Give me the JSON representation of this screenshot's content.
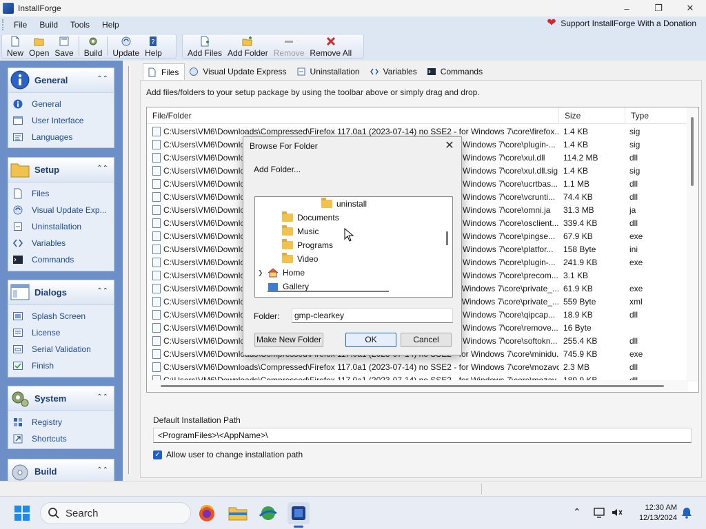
{
  "app": {
    "title": "InstallForge"
  },
  "menu": [
    "File",
    "Build",
    "Tools",
    "Help"
  ],
  "donate": "Support InstallForge With a Donation",
  "toolbar": {
    "new": "New",
    "open": "Open",
    "save": "Save",
    "build": "Build",
    "update": "Update",
    "help": "Help",
    "add_files": "Add Files",
    "add_folder": "Add Folder",
    "remove": "Remove",
    "remove_all": "Remove All"
  },
  "sidebar": {
    "general": {
      "title": "General",
      "items": [
        "General",
        "User Interface",
        "Languages"
      ]
    },
    "setup": {
      "title": "Setup",
      "items": [
        "Files",
        "Visual Update Exp...",
        "Uninstallation",
        "Variables",
        "Commands"
      ]
    },
    "dialogs": {
      "title": "Dialogs",
      "items": [
        "Splash Screen",
        "License",
        "Serial Validation",
        "Finish"
      ]
    },
    "system": {
      "title": "System",
      "items": [
        "Registry",
        "Shortcuts"
      ]
    },
    "build": {
      "title": "Build"
    }
  },
  "tabs": [
    "Files",
    "Visual Update Express",
    "Uninstallation",
    "Variables",
    "Commands"
  ],
  "files": {
    "hint": "Add files/folders to your setup package by using the toolbar above or simply drag and drop.",
    "columns": [
      "File/Folder",
      "Size",
      "Type"
    ],
    "rows": [
      [
        "C:\\Users\\VM6\\Downloads\\Compressed\\Firefox 117.0a1 (2023-07-14) no SSE2 - for Windows 7\\core\\firefox....",
        "1.4 KB",
        "sig"
      ],
      [
        "C:\\Users\\VM6\\Downlo",
        "Windows 7\\core\\plugin-...",
        "1.4 KB",
        "sig"
      ],
      [
        "C:\\Users\\VM6\\Downlo",
        "Windows 7\\core\\xul.dll",
        "114.2 MB",
        "dll"
      ],
      [
        "C:\\Users\\VM6\\Downlo",
        "Windows 7\\core\\xul.dll.sig",
        "1.4 KB",
        "sig"
      ],
      [
        "C:\\Users\\VM6\\Downlo",
        "Windows 7\\core\\ucrtbas...",
        "1.1 MB",
        "dll"
      ],
      [
        "C:\\Users\\VM6\\Downlo",
        "Windows 7\\core\\vcrunti...",
        "74.4 KB",
        "dll"
      ],
      [
        "C:\\Users\\VM6\\Downlo",
        "Windows 7\\core\\omni.ja",
        "31.3 MB",
        "ja"
      ],
      [
        "C:\\Users\\VM6\\Downlo",
        "Windows 7\\core\\osclient...",
        "339.4 KB",
        "dll"
      ],
      [
        "C:\\Users\\VM6\\Downlo",
        "Windows 7\\core\\pingse...",
        "67.9 KB",
        "exe"
      ],
      [
        "C:\\Users\\VM6\\Downlo",
        "Windows 7\\core\\platfor...",
        "158 Byte",
        "ini"
      ],
      [
        "C:\\Users\\VM6\\Downlo",
        "Windows 7\\core\\plugin-...",
        "241.9 KB",
        "exe"
      ],
      [
        "C:\\Users\\VM6\\Downlo",
        "Windows 7\\core\\precom...",
        "3.1 KB",
        ""
      ],
      [
        "C:\\Users\\VM6\\Downlo",
        "Windows 7\\core\\private_...",
        "61.9 KB",
        "exe"
      ],
      [
        "C:\\Users\\VM6\\Downlo",
        "Windows 7\\core\\private_...",
        "559 Byte",
        "xml"
      ],
      [
        "C:\\Users\\VM6\\Downlo",
        "Windows 7\\core\\qipcap...",
        "18.9 KB",
        "dll"
      ],
      [
        "C:\\Users\\VM6\\Downlo",
        "Windows 7\\core\\remove...",
        "16 Byte",
        ""
      ],
      [
        "C:\\Users\\VM6\\Downlo",
        "Windows 7\\core\\softokn...",
        "255.4 KB",
        "dll"
      ],
      [
        "C:\\Users\\VM6\\Downloads\\Compressed\\Firefox 117.0a1 (2023-07-14) no SSE2 - for Windows 7\\core\\minidu...",
        "745.9 KB",
        "exe"
      ],
      [
        "C:\\Users\\VM6\\Downloads\\Compressed\\Firefox 117.0a1 (2023-07-14) no SSE2 - for Windows 7\\core\\mozavc...",
        "2.3 MB",
        "dll"
      ],
      [
        "C:\\Users\\VM6\\Downloads\\Compressed\\Firefox 117.0a1 (2023-07-14) no SSE2 - for Windows 7\\core\\mozav...",
        "189.9 KB",
        "dll"
      ]
    ]
  },
  "install_path": {
    "label": "Default Installation Path",
    "value": "<ProgramFiles>\\<AppName>\\",
    "allow_change": "Allow user to change installation path"
  },
  "dialog": {
    "title": "Browse For Folder",
    "description": "Add Folder...",
    "tree": [
      "uninstall",
      "Documents",
      "Music",
      "Programs",
      "Video",
      "Home",
      "Gallery"
    ],
    "folder_label": "Folder:",
    "folder_value": "gmp-clearkey",
    "make_new_folder": "Make New Folder",
    "ok": "OK",
    "cancel": "Cancel"
  },
  "taskbar": {
    "search": "Search",
    "time": "12:30 AM",
    "date": "12/13/2024"
  }
}
